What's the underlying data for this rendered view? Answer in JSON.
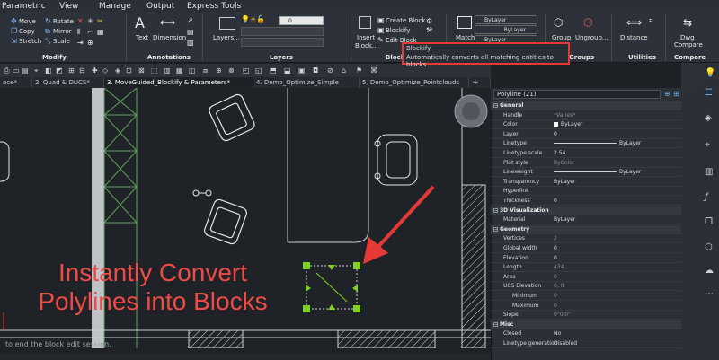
{
  "menu": [
    "Parametric",
    "View",
    "Manage",
    "Output",
    "Express Tools"
  ],
  "ribbon": {
    "modify": {
      "label": "Modify",
      "move": "Move",
      "copy": "Copy",
      "stretch": "Stretch",
      "rotate": "Rotate",
      "mirror": "Mirror",
      "scale": "Scale"
    },
    "annotations": {
      "label": "Annotations",
      "text": "Text",
      "dimension": "Dimension"
    },
    "layers": {
      "label": "Layers",
      "layers_btn": "Layers...",
      "layer_value": "0"
    },
    "blocks": {
      "insert": "Insert",
      "block": "Block...",
      "create": "Create Block",
      "blockify": "Blockify",
      "edit": "Edit Block",
      "label_partial": "Block"
    },
    "properties": {
      "match": "Match",
      "bylayer1": "ByLayer",
      "bylayer2": "ByLayer",
      "bylayer3": "ByLayer"
    },
    "groups": {
      "group": "Group",
      "ungroup": "Ungroup...",
      "label": "Groups"
    },
    "utilities": {
      "distance": "Distance",
      "label": "Utilities"
    },
    "compare": {
      "dwg": "Dwg",
      "compare_btn": "Compare",
      "label": "Compare"
    }
  },
  "tooltip": {
    "title": "Blockify",
    "description": "Automatically converts all matching entities to blocks"
  },
  "tabs": [
    "ace*",
    "2. Quad & DUCS*",
    "3. MoveGuided_Blockify & Parameters*",
    "4. Demo_Optimize_Simple",
    "5. Demo_Optimize_Pointclouds"
  ],
  "tabs_add": "+",
  "overlay": {
    "line1": "Instantly Convert",
    "line2": "Polylines into Blocks"
  },
  "command_line": "to end the block edit session.",
  "properties_panel": {
    "selection": "Polyline (21)",
    "sections": [
      {
        "name": "General",
        "rows": [
          {
            "label": "Handle",
            "value": "*Varies*",
            "grey": true
          },
          {
            "label": "Color",
            "value": "ByLayer",
            "swatch": true
          },
          {
            "label": "Layer",
            "value": "0"
          },
          {
            "label": "Linetype",
            "value": "ByLayer",
            "line": true
          },
          {
            "label": "Linetype scale",
            "value": "2.54"
          },
          {
            "label": "Plot style",
            "value": "ByColor",
            "grey": true
          },
          {
            "label": "Lineweight",
            "value": "ByLayer",
            "line": true
          },
          {
            "label": "Transparency",
            "value": "ByLayer"
          },
          {
            "label": "Hyperlink",
            "value": ""
          },
          {
            "label": "Thickness",
            "value": "0"
          }
        ]
      },
      {
        "name": "3D Visualization",
        "rows": [
          {
            "label": "Material",
            "value": "ByLayer"
          }
        ]
      },
      {
        "name": "Geometry",
        "rows": [
          {
            "label": "Vertices",
            "value": "2",
            "grey": true
          },
          {
            "label": "Global width",
            "value": "0"
          },
          {
            "label": "Elevation",
            "value": "0"
          },
          {
            "label": "Length",
            "value": "434",
            "grey": true
          },
          {
            "label": "Area",
            "value": "0",
            "grey": true
          },
          {
            "label": "UCS Elevation",
            "value": "0, 0",
            "grey": true
          },
          {
            "label": "Minimum",
            "value": "0",
            "grey": true,
            "indent": true
          },
          {
            "label": "Maximum",
            "value": "0",
            "grey": true,
            "indent": true
          },
          {
            "label": "Slope",
            "value": "0°0'0\"",
            "grey": true
          }
        ]
      },
      {
        "name": "Misc",
        "rows": [
          {
            "label": "Closed",
            "value": "No"
          },
          {
            "label": "Linetype generation",
            "value": "Disabled"
          }
        ]
      }
    ]
  },
  "colors": {
    "accent_red": "#e53935",
    "overlay_red": "#ee4b46",
    "select_green": "#7ed321",
    "ucs_red": "#e53935"
  }
}
